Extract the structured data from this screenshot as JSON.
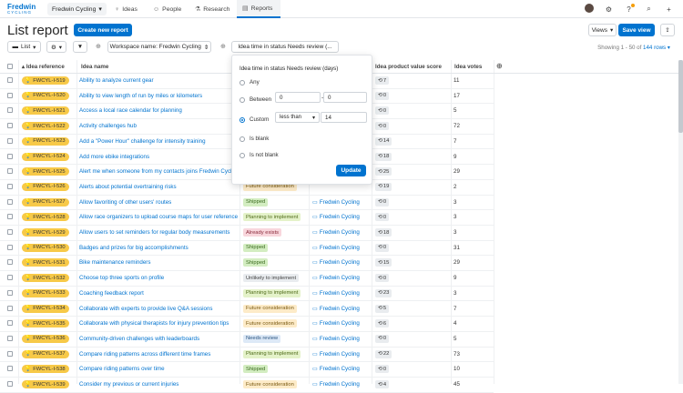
{
  "app": {
    "logo_top": "Fredwin",
    "logo_bottom": "CYCLING",
    "workspace": "Fredwin Cycling",
    "nav_tabs": [
      {
        "label": "Ideas",
        "icon": "lightbulb-icon"
      },
      {
        "label": "People",
        "icon": "person-icon"
      },
      {
        "label": "Research",
        "icon": "flask-icon"
      },
      {
        "label": "Reports",
        "icon": "chart-icon",
        "active": true
      }
    ]
  },
  "page": {
    "title": "List report",
    "create_button": "Create new report",
    "views_button": "Views",
    "save_view_button": "Save view"
  },
  "toolbar": {
    "list_label": "List",
    "filter_workspace": "Workspace name: Fredwin Cycling",
    "filter_time": "Idea time in status Needs review (...",
    "rowcount_prefix": "Showing 1 - 50 of ",
    "rowcount_total": "144 rows"
  },
  "columns": {
    "ref": "Idea reference",
    "name": "Idea name",
    "score": "Idea product value score",
    "votes": "Idea votes"
  },
  "rows": [
    {
      "ref": "FWCYL-I-519",
      "name": "Ability to analyze current gear",
      "status": "",
      "category": "",
      "score": "7",
      "votes": "11"
    },
    {
      "ref": "FWCYL-I-520",
      "name": "Ability to view length of run by miles or kilometers",
      "status": "",
      "category": "",
      "score": "0",
      "votes": "17"
    },
    {
      "ref": "FWCYL-I-521",
      "name": "Access a local race calendar for planning",
      "status": "",
      "category": "",
      "score": "0",
      "votes": "5"
    },
    {
      "ref": "FWCYL-I-522",
      "name": "Activity challenges hub",
      "status": "",
      "category": "",
      "score": "0",
      "votes": "72"
    },
    {
      "ref": "FWCYL-I-523",
      "name": "Add a \"Power Hour\" challenge for intensity training",
      "status": "",
      "category": "",
      "score": "14",
      "votes": "7"
    },
    {
      "ref": "FWCYL-I-524",
      "name": "Add more ebike integrations",
      "status": "",
      "category": "",
      "score": "18",
      "votes": "9"
    },
    {
      "ref": "FWCYL-I-525",
      "name": "Alert me when someone from my contacts joins Fredwin Cycling",
      "status": "",
      "category": "",
      "score": "25",
      "votes": "29"
    },
    {
      "ref": "FWCYL-I-526",
      "name": "Alerts about potential overtraining risks",
      "status": "Future consideration",
      "category": "",
      "score": "19",
      "votes": "2"
    },
    {
      "ref": "FWCYL-I-527",
      "name": "Allow favoriting of other users' routes",
      "status": "Shipped",
      "category": "Fredwin Cycling",
      "score": "0",
      "votes": "3"
    },
    {
      "ref": "FWCYL-I-528",
      "name": "Allow race organizers to upload course maps for user reference",
      "status": "Planning to implement",
      "category": "Fredwin Cycling",
      "score": "0",
      "votes": "3"
    },
    {
      "ref": "FWCYL-I-529",
      "name": "Allow users to set reminders for regular body measurements",
      "status": "Already exists",
      "category": "Fredwin Cycling",
      "score": "18",
      "votes": "3"
    },
    {
      "ref": "FWCYL-I-530",
      "name": "Badges and prizes for big accomplishments",
      "status": "Shipped",
      "category": "Fredwin Cycling",
      "score": "0",
      "votes": "31"
    },
    {
      "ref": "FWCYL-I-531",
      "name": "Bike maintenance reminders",
      "status": "Shipped",
      "category": "Fredwin Cycling",
      "score": "15",
      "votes": "29"
    },
    {
      "ref": "FWCYL-I-532",
      "name": "Choose top three sports on profile",
      "status": "Unlikely to implement",
      "category": "Fredwin Cycling",
      "score": "0",
      "votes": "9"
    },
    {
      "ref": "FWCYL-I-533",
      "name": "Coaching feedback report",
      "status": "Planning to implement",
      "category": "Fredwin Cycling",
      "score": "23",
      "votes": "3"
    },
    {
      "ref": "FWCYL-I-534",
      "name": "Collaborate with experts to provide live Q&A sessions",
      "status": "Future consideration",
      "category": "Fredwin Cycling",
      "score": "5",
      "votes": "7"
    },
    {
      "ref": "FWCYL-I-535",
      "name": "Collaborate with physical therapists for injury prevention tips",
      "status": "Future consideration",
      "category": "Fredwin Cycling",
      "score": "6",
      "votes": "4"
    },
    {
      "ref": "FWCYL-I-536",
      "name": "Community-driven challenges with leaderboards",
      "status": "Needs review",
      "category": "Fredwin Cycling",
      "score": "0",
      "votes": "5"
    },
    {
      "ref": "FWCYL-I-537",
      "name": "Compare riding patterns across different time frames",
      "status": "Planning to implement",
      "category": "Fredwin Cycling",
      "score": "22",
      "votes": "73"
    },
    {
      "ref": "FWCYL-I-538",
      "name": "Compare riding patterns over time",
      "status": "Shipped",
      "category": "Fredwin Cycling",
      "score": "0",
      "votes": "10"
    },
    {
      "ref": "FWCYL-I-539",
      "name": "Consider my previous or current injuries",
      "status": "Future consideration",
      "category": "Fredwin Cycling",
      "score": "4",
      "votes": "45"
    }
  ],
  "status_colors": {
    "Future consideration": {
      "bg": "#fdebc8",
      "fg": "#7a5a12"
    },
    "Shipped": {
      "bg": "#d3edc1",
      "fg": "#3b6b1f"
    },
    "Planning to implement": {
      "bg": "#e4f2c9",
      "fg": "#4f6b1a"
    },
    "Already exists": {
      "bg": "#f8d6dc",
      "fg": "#8a2c3c"
    },
    "Unlikely to implement": {
      "bg": "#e9ecef",
      "fg": "#444"
    },
    "Needs review": {
      "bg": "#dde9f7",
      "fg": "#2b5580"
    }
  },
  "popover": {
    "title": "Idea time in status Needs review (days)",
    "opt_any": "Any",
    "opt_between": "Between",
    "between_from": "0",
    "between_sep": "-",
    "between_to": "0",
    "opt_custom": "Custom",
    "custom_operator": "less than",
    "custom_value": "14",
    "opt_blank": "Is blank",
    "opt_not_blank": "Is not blank",
    "update_button": "Update"
  }
}
